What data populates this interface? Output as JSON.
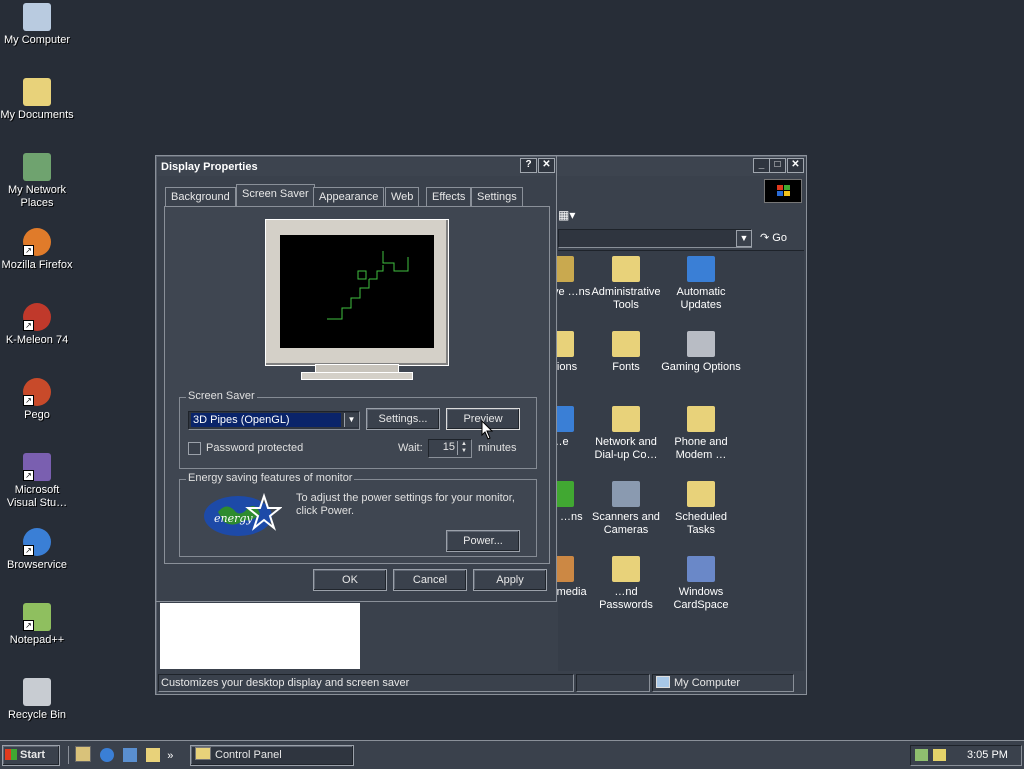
{
  "desktop_icons": [
    {
      "label": "My Computer",
      "icon": "computer-icon",
      "shortcut": false
    },
    {
      "label": "My Documents",
      "icon": "folder-documents-icon",
      "shortcut": false
    },
    {
      "label": "My Network Places",
      "icon": "network-places-icon",
      "shortcut": false
    },
    {
      "label": "Mozilla Firefox",
      "icon": "firefox-icon",
      "shortcut": true
    },
    {
      "label": "K-Meleon 74",
      "icon": "kmeleon-icon",
      "shortcut": true
    },
    {
      "label": "Pego",
      "icon": "pego-icon",
      "shortcut": true
    },
    {
      "label": "Microsoft Visual Stu…",
      "icon": "visual-studio-icon",
      "shortcut": true
    },
    {
      "label": "Browservice",
      "icon": "internet-explorer-icon",
      "shortcut": true
    },
    {
      "label": "Notepad++",
      "icon": "notepad-plus-plus-icon",
      "shortcut": true
    },
    {
      "label": "Recycle Bin",
      "icon": "recycle-bin-icon",
      "shortcut": false
    }
  ],
  "control_panel": {
    "go_label": "Go",
    "status_text": "Customizes your desktop display and screen saver",
    "status_location": "My Computer",
    "items": [
      {
        "label": "…nove …ns",
        "icon": "add-remove-icon"
      },
      {
        "label": "Administrative Tools",
        "icon": "admin-tools-icon"
      },
      {
        "label": "Automatic Updates",
        "icon": "windows-update-icon"
      },
      {
        "label": "…tions",
        "icon": "folder-options-icon"
      },
      {
        "label": "Fonts",
        "icon": "fonts-folder-icon"
      },
      {
        "label": "Gaming Options",
        "icon": "joystick-icon"
      },
      {
        "label": "…e",
        "icon": "internet-icon"
      },
      {
        "label": "Network and Dial-up Co…",
        "icon": "network-connections-icon"
      },
      {
        "label": "Phone and Modem …",
        "icon": "phone-icon"
      },
      {
        "label": "…al …ns",
        "icon": "regional-icon"
      },
      {
        "label": "Scanners and Cameras",
        "icon": "scanner-icon"
      },
      {
        "label": "Scheduled Tasks",
        "icon": "scheduled-tasks-icon"
      },
      {
        "label": "Multimedia",
        "icon": "multimedia-icon"
      },
      {
        "label": "…nd Passwords",
        "icon": "users-icon"
      },
      {
        "label": "Windows CardSpace",
        "icon": "cardspace-icon"
      }
    ]
  },
  "display_properties": {
    "title": "Display Properties",
    "tabs": [
      "Background",
      "Screen Saver",
      "Appearance",
      "Web",
      "Effects",
      "Settings"
    ],
    "active_tab": "Screen Saver",
    "screen_saver_group": "Screen Saver",
    "screen_saver_value": "3D Pipes (OpenGL)",
    "settings_btn": "Settings...",
    "preview_btn": "Preview",
    "password_label": "Password protected",
    "wait_label": "Wait:",
    "wait_value": "15",
    "minutes_label": "minutes",
    "energy_group": "Energy saving features of monitor",
    "energy_text": "To adjust the power settings for your monitor, click Power.",
    "energy_logo_text": "energy",
    "power_btn": "Power...",
    "ok": "OK",
    "cancel": "Cancel",
    "apply": "Apply"
  },
  "taskbar": {
    "start": "Start",
    "task": "Control Panel",
    "overflow": "»",
    "clock": "3:05 PM"
  },
  "colors": {
    "desktop": "#272d37",
    "window": "#3a414c",
    "selection": "#0a246a"
  }
}
